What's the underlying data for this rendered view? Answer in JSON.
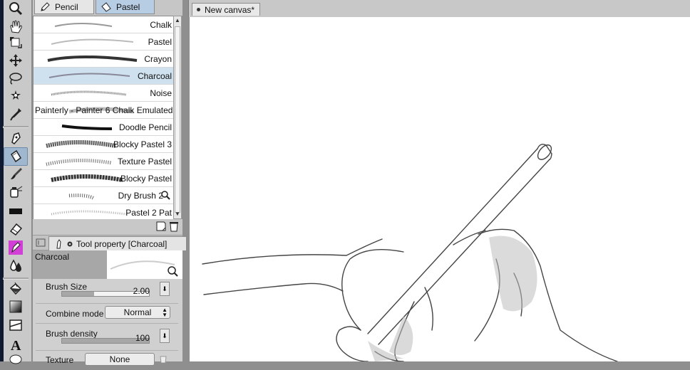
{
  "tool_tabs": {
    "pencil": "Pencil",
    "pastel": "Pastel"
  },
  "brushes": [
    {
      "label": "Chalk"
    },
    {
      "label": "Pastel"
    },
    {
      "label": "Crayon"
    },
    {
      "label": "Charcoal",
      "selected": true
    },
    {
      "label": "Noise"
    },
    {
      "label": "Painterly - Painter 6 Chalk Emulated"
    },
    {
      "label": "Doodle Pencil"
    },
    {
      "label": "Blocky Pastel 3"
    },
    {
      "label": "Texture Pastel"
    },
    {
      "label": "Blocky Pastel"
    },
    {
      "label": "Dry Brush 2"
    },
    {
      "label": "Pastel 2 Pat"
    }
  ],
  "tool_property": {
    "title": "Tool property [Charcoal]",
    "preview_name": "Charcoal",
    "brush_size": {
      "label": "Brush Size",
      "value": "2.00",
      "fill": 0.37
    },
    "combine_mode": {
      "label": "Combine mode",
      "value": "Normal"
    },
    "brush_density": {
      "label": "Brush density",
      "value": "100",
      "fill": 1.0
    },
    "texture": {
      "label": "Texture",
      "value": "None"
    }
  },
  "canvas": {
    "tab_title": "New canvas*"
  },
  "colors": {
    "selection": "#cfe0ee",
    "active_tab": "#b7cde3",
    "panel": "#c9c9c9",
    "tool_pink": "#d23fd6"
  }
}
